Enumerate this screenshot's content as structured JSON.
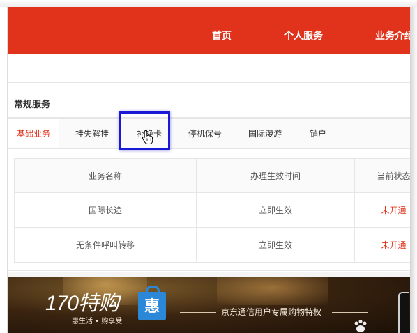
{
  "header": {
    "nav": [
      "首页",
      "个人服务",
      "业务介绍"
    ]
  },
  "section": {
    "title": "常规服务"
  },
  "tabs": [
    {
      "label": "基础业务",
      "active": true
    },
    {
      "label": "挂失解挂",
      "active": false
    },
    {
      "label": "补换卡",
      "active": false,
      "hovered": true
    },
    {
      "label": "停机保号",
      "active": false
    },
    {
      "label": "国际漫游",
      "active": false
    },
    {
      "label": "销户",
      "active": false
    }
  ],
  "table": {
    "headers": [
      "业务名称",
      "办理生效时间",
      "当前状态"
    ],
    "rows": [
      [
        "国际长途",
        "立即生效",
        "未开通"
      ],
      [
        "无条件呼叫转移",
        "立即生效",
        "未开通"
      ]
    ]
  },
  "banner": {
    "logo": "170特购",
    "bag_char": "惠",
    "slogan": "惠生活 • 购享受",
    "text": "京东通信用户专属购物特权"
  },
  "colors": {
    "brand_red": "#e1331c",
    "highlight_blue": "#1a1ad6",
    "bag_blue": "#2b87d8"
  },
  "icons": [
    "hand-cursor-icon",
    "paw-icon"
  ]
}
